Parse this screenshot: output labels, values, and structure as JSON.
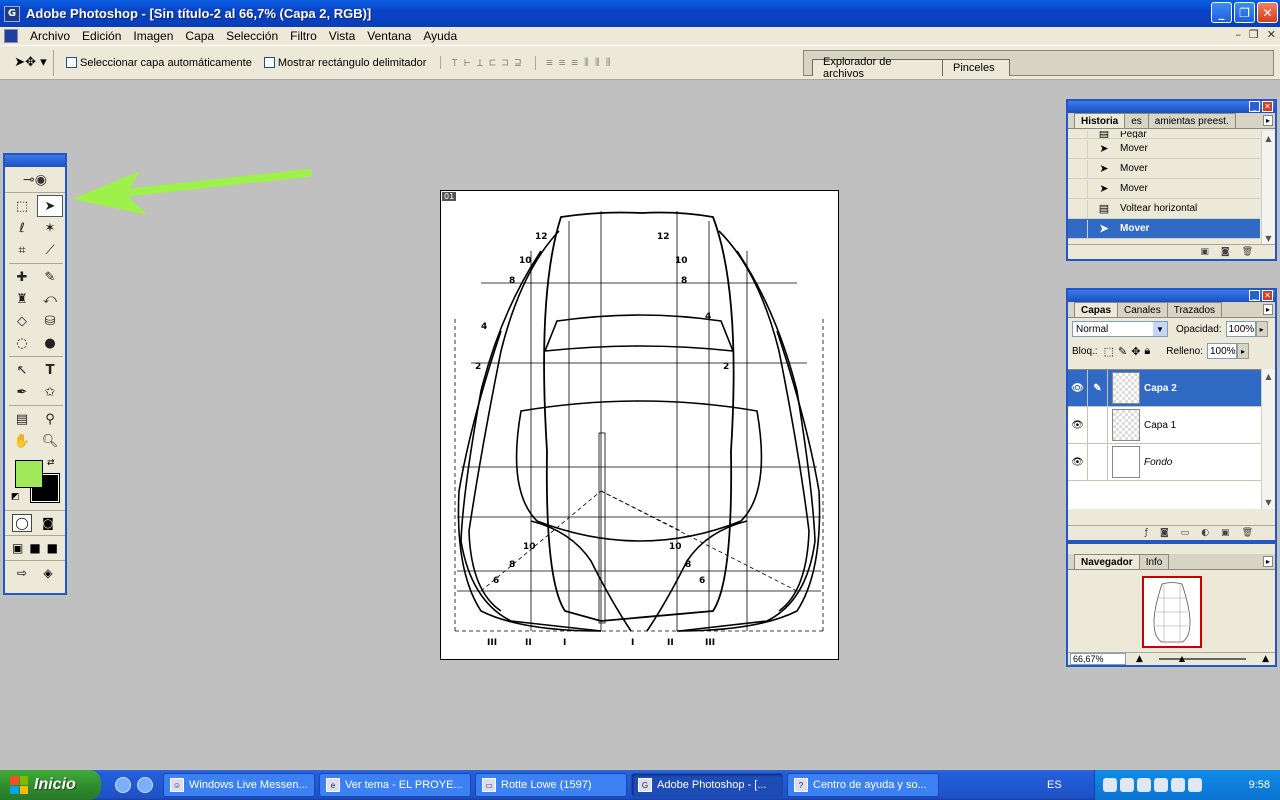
{
  "window": {
    "title": "Adobe Photoshop - [Sin título-2 al 66,7% (Capa 2, RGB)]",
    "app_icon_glyph": "G"
  },
  "menu": [
    "Archivo",
    "Edición",
    "Imagen",
    "Capa",
    "Selección",
    "Filtro",
    "Vista",
    "Ventana",
    "Ayuda"
  ],
  "options": {
    "auto_select_label": "Seleccionar capa automáticamente",
    "show_bounds_label": "Mostrar rectángulo delimitador",
    "well_tabs": [
      "Explorador de archivos",
      "Pinceles"
    ]
  },
  "document": {
    "tab_label": "01"
  },
  "history": {
    "tabs": [
      "Historia",
      "es",
      "amientas preest."
    ],
    "items": [
      {
        "label": "Pegar",
        "icon": "paste-icon"
      },
      {
        "label": "Mover",
        "icon": "move-icon"
      },
      {
        "label": "Mover",
        "icon": "move-icon"
      },
      {
        "label": "Mover",
        "icon": "move-icon"
      },
      {
        "label": "Voltear horizontal",
        "icon": "flip-icon"
      },
      {
        "label": "Mover",
        "icon": "move-icon",
        "selected": true
      }
    ]
  },
  "layers": {
    "tabs": [
      "Capas",
      "Canales",
      "Trazados"
    ],
    "blend_mode": "Normal",
    "opacity_label": "Opacidad:",
    "opacity_value": "100%",
    "lock_label": "Bloq.:",
    "fill_label": "Relleno:",
    "fill_value": "100%",
    "items": [
      {
        "name": "Capa 2",
        "selected": true
      },
      {
        "name": "Capa 1",
        "selected": false
      },
      {
        "name": "Fondo",
        "selected": false,
        "locked": true
      }
    ]
  },
  "navigator": {
    "tabs": [
      "Navegador",
      "Info"
    ],
    "zoom": "66,67%"
  },
  "colors": {
    "foreground": "#9ee85a",
    "background": "#000000",
    "arrow": "#9ef04a",
    "selection": "#316ac5"
  },
  "taskbar": {
    "start_label": "Inicio",
    "tasks": [
      {
        "label": "Windows Live Messen...",
        "active": false
      },
      {
        "label": "Ver tema - EL PROYE...",
        "active": false
      },
      {
        "label": "Rotte Lowe   (1597)",
        "active": false
      },
      {
        "label": "Adobe Photoshop - [...",
        "active": true
      },
      {
        "label": "Centro de ayuda y so...",
        "active": false
      }
    ],
    "language": "ES",
    "clock": "9:58"
  }
}
